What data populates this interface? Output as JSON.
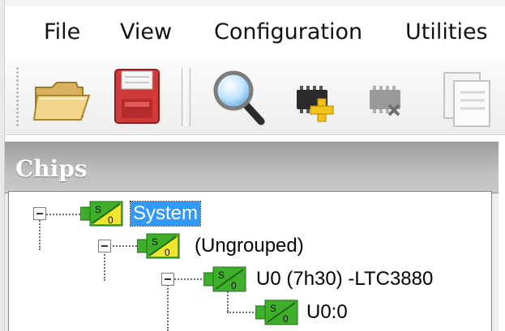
{
  "menu": {
    "items": [
      {
        "label": "File"
      },
      {
        "label": "View"
      },
      {
        "label": "Configuration"
      },
      {
        "label": "Utilities"
      }
    ]
  },
  "toolbar": {
    "buttons": [
      {
        "icon": "open-folder-icon",
        "enabled": true
      },
      {
        "icon": "save-disk-icon",
        "enabled": true
      },
      {
        "icon": "magnifier-icon",
        "enabled": true
      },
      {
        "icon": "add-chip-icon",
        "enabled": true
      },
      {
        "icon": "remove-chip-icon",
        "enabled": false
      },
      {
        "icon": "copy-document-icon",
        "enabled": false
      }
    ]
  },
  "panel": {
    "title": "Chips"
  },
  "tree": {
    "nodes": [
      {
        "label": "System",
        "selected": true,
        "expanded": true
      },
      {
        "label": "(Ungrouped)",
        "selected": false,
        "expanded": true
      },
      {
        "label": "U0 (7h30) -LTC3880",
        "selected": false,
        "expanded": true
      },
      {
        "label": "U0:0",
        "selected": false,
        "expanded": false
      }
    ],
    "icon_label": "S/0"
  },
  "colors": {
    "selection": "#3399ff",
    "chip_green": "#3fae2a",
    "chip_yellow": "#f2e530",
    "panel_header": "#b4b4b4"
  }
}
